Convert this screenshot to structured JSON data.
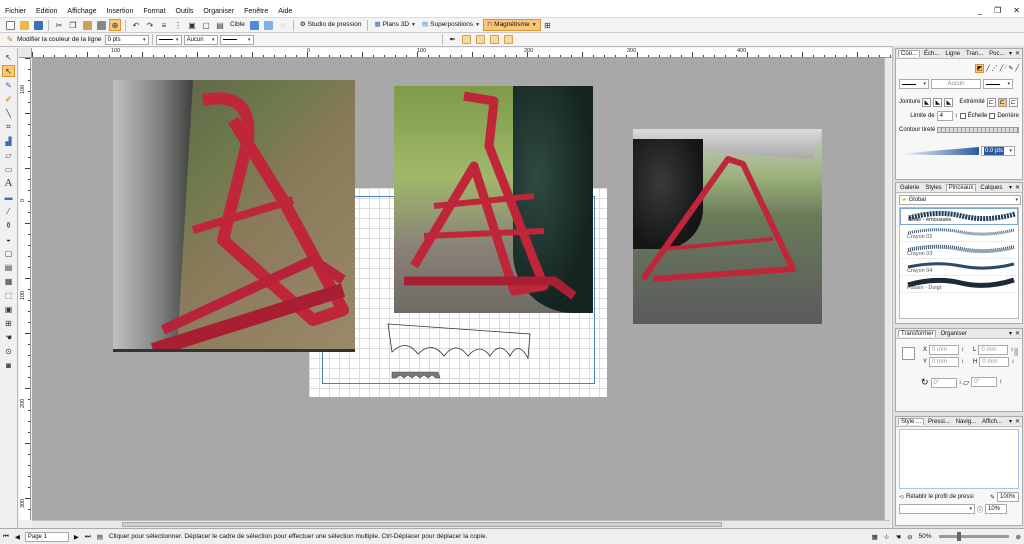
{
  "window": {
    "title": ""
  },
  "menu": [
    "Fichier",
    "Edition",
    "Affichage",
    "Insertion",
    "Format",
    "Outils",
    "Organiser",
    "Fenêtre",
    "Aide"
  ],
  "toolbar": {
    "cible": "Cible",
    "studio": "Studio de pression",
    "plans3d": "Plans 3D",
    "superpositions": "Superpositions",
    "magnetisme": "Magnétisme"
  },
  "property_bar": {
    "line_color_label": "Modifier la couleur de la ligne",
    "line_width": "0 pts",
    "arrow_style": "Aucun"
  },
  "rulers": {
    "h_ticks": [
      {
        "label": "100",
        "pos": "0.09"
      },
      {
        "label": "0",
        "pos": "0.318"
      },
      {
        "label": "100",
        "pos": "0.446"
      },
      {
        "label": "200",
        "pos": "0.57"
      },
      {
        "label": "300",
        "pos": "0.69"
      },
      {
        "label": "400",
        "pos": "0.818"
      }
    ],
    "v_ticks": [
      "100",
      "0",
      "100",
      "200",
      "300"
    ]
  },
  "outline_panel": {
    "tabs": [
      "Cou...",
      "Éch...",
      "Ligne",
      "Tran...",
      "Poc..."
    ],
    "arrow_value": "Aucun",
    "jointure_label": "Jointure",
    "extremite_label": "Extrémité",
    "limite_label": "Limite de",
    "limite_value": "4",
    "echelle_label": "Échelle",
    "derriere_label": "Derrière",
    "contour_label": "Contour tireté",
    "width_value": "0.0 pts"
  },
  "brush_panel": {
    "tabs": [
      "Galerie",
      "Styles",
      "Pinceaux",
      "Calques"
    ],
    "folder": "Global",
    "brushes": [
      "Craie - émoussée",
      "Crayon 02",
      "Crayon 03",
      "Crayon 04",
      "Fusain - Doigt"
    ]
  },
  "transform_panel": {
    "tabs": [
      "Transformer",
      "Organiser"
    ],
    "x_label": "X",
    "x_value": "0 mm",
    "y_label": "Y",
    "y_value": "0 mm",
    "l_label": "L",
    "l_value": "0 mm",
    "h_label": "H",
    "h_value": "0 mm",
    "rot_value": "0°",
    "skew_value": "0°"
  },
  "bottom_panel": {
    "tabs": [
      "Style ...",
      "Pressi...",
      "Navig...",
      "Affich..."
    ],
    "reset_label": "Rétablir le profil de pressi",
    "value1": "100%",
    "value2": "10%"
  },
  "statusbar": {
    "page": "Page 1",
    "message": "Cliquer pour sélectionner. Déplacer le cadre de sélection pour effectuer une sélection multiple. Ctrl-Déplacer pour déplacer la copie.",
    "zoom": "50%"
  }
}
